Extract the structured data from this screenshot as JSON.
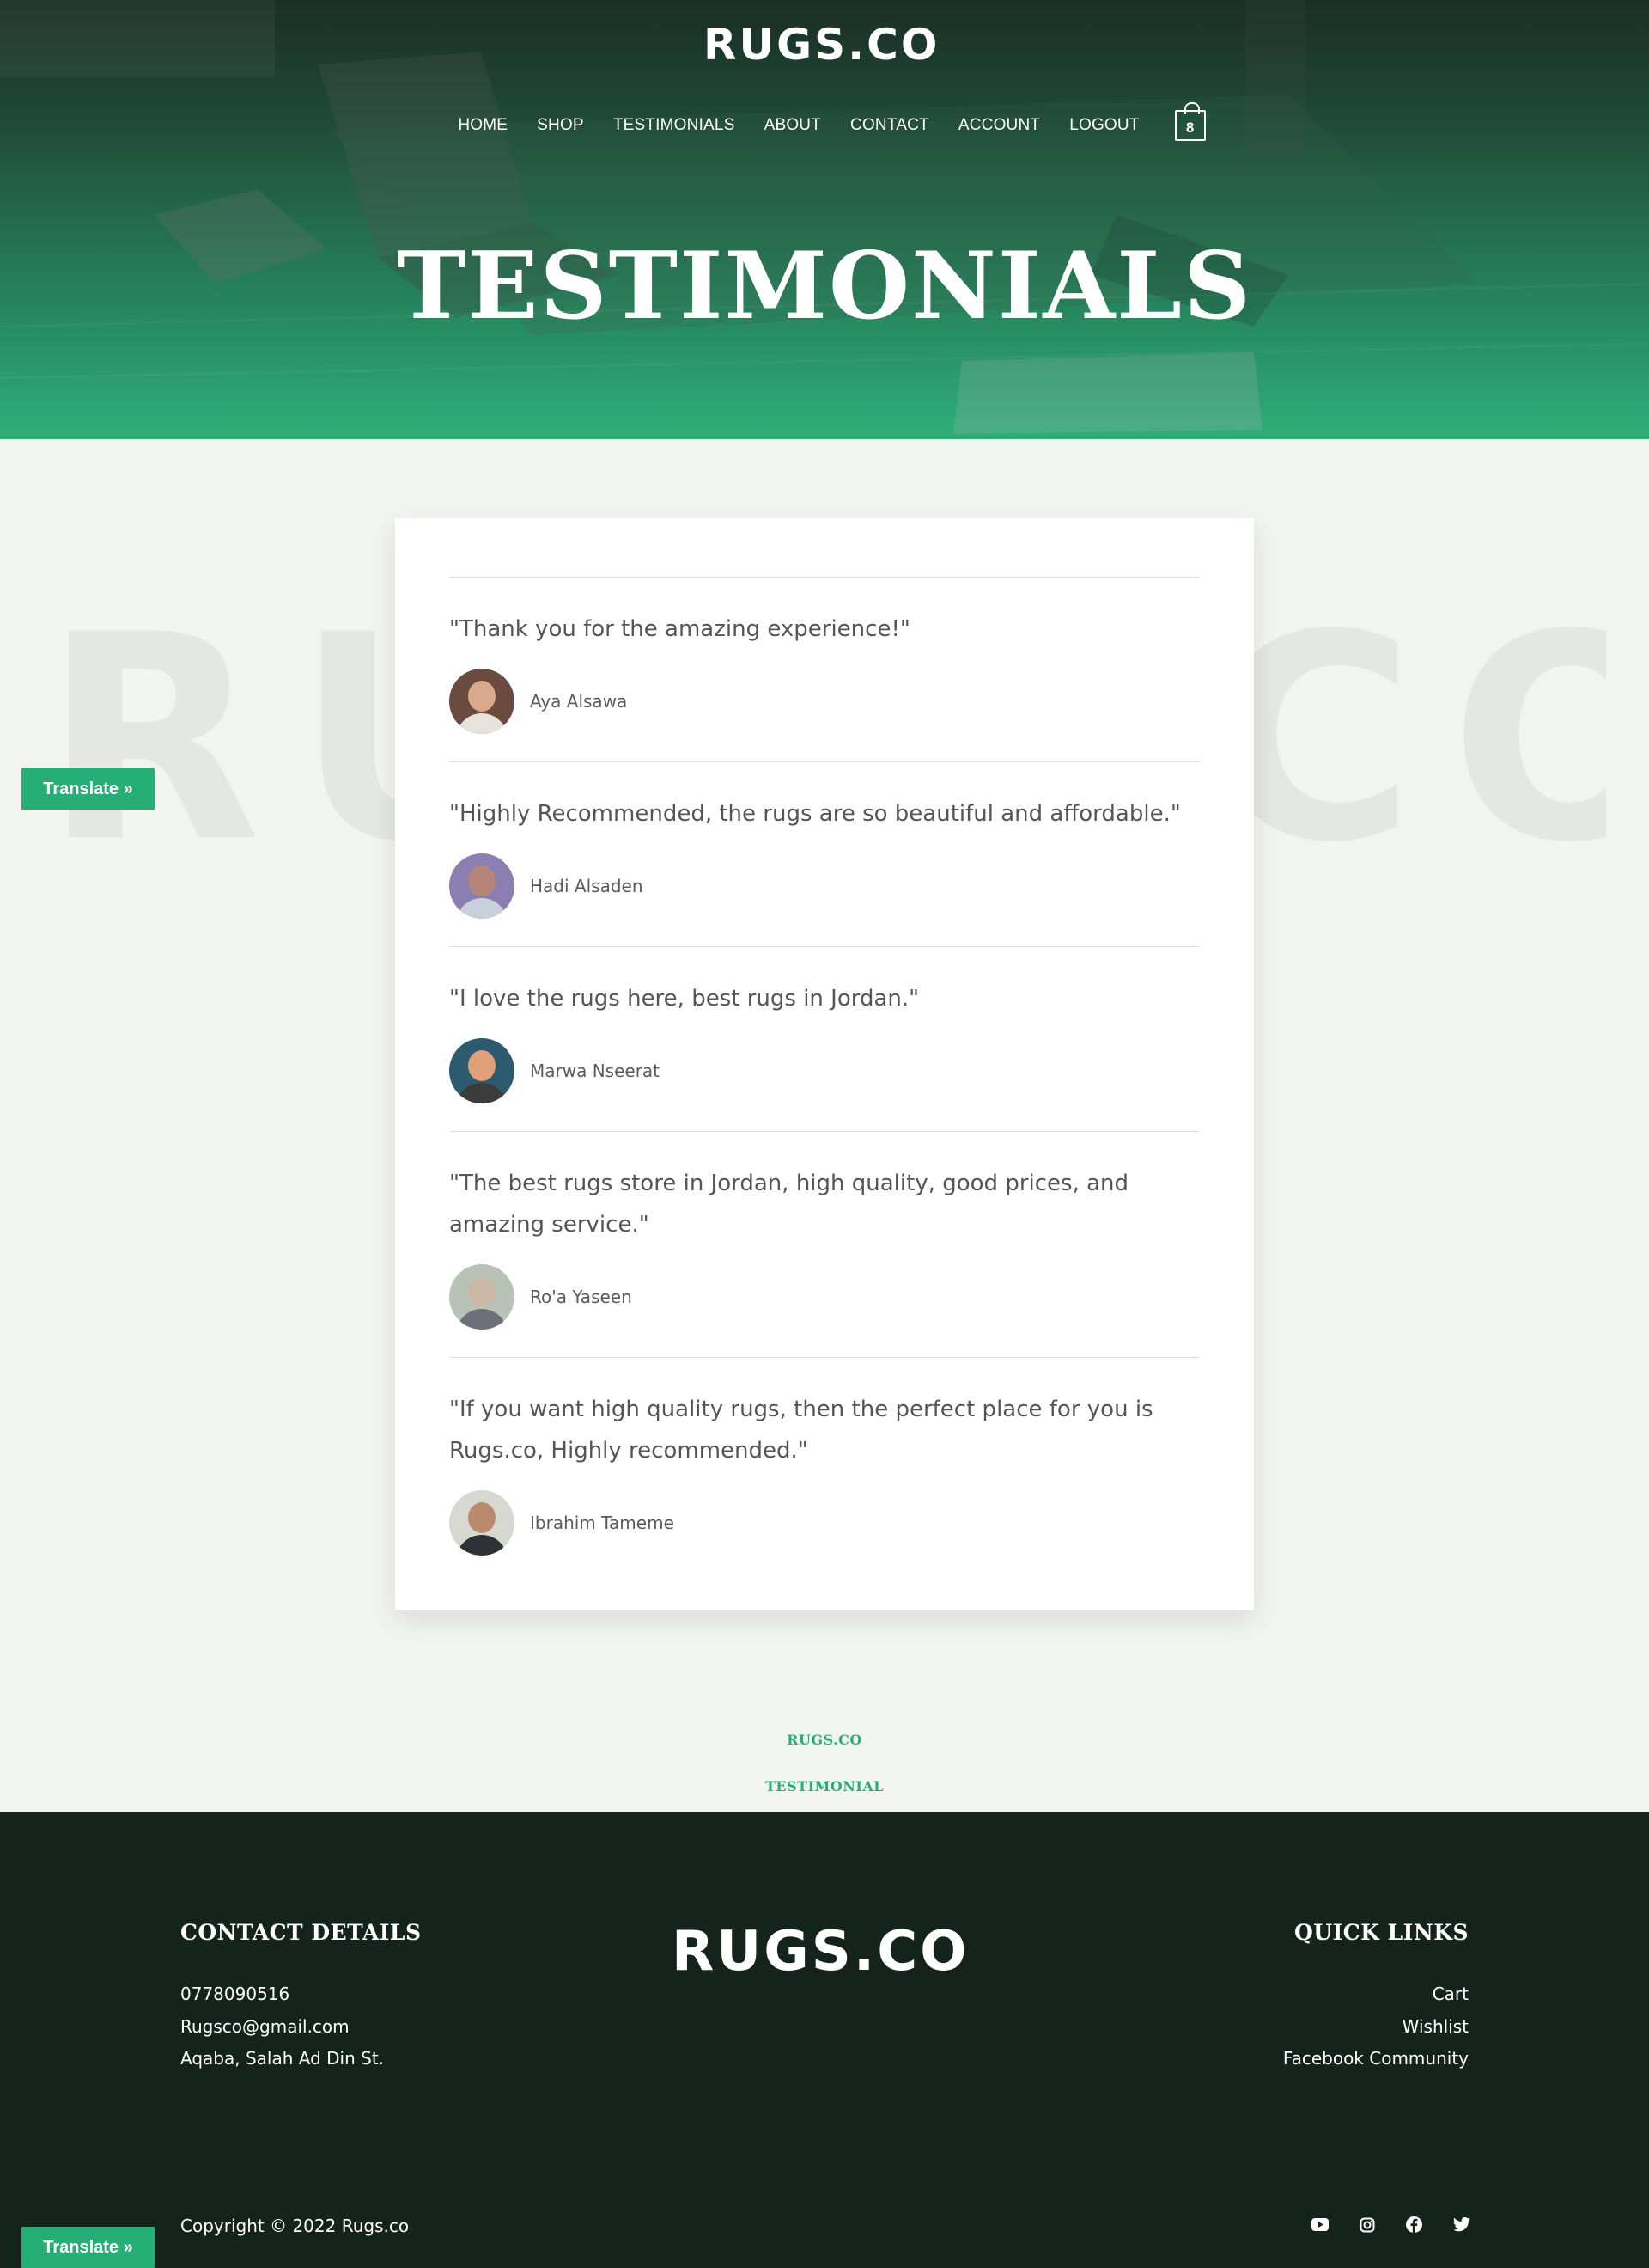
{
  "brand": {
    "logo_text": "RUGS.CO"
  },
  "nav": {
    "items": [
      "HOME",
      "SHOP",
      "TESTIMONIALS",
      "ABOUT",
      "CONTACT",
      "ACCOUNT",
      "LOGOUT"
    ],
    "cart_count": "8"
  },
  "hero": {
    "title": "TESTIMONIALS"
  },
  "translate": {
    "label": "Translate »"
  },
  "testimonials": [
    {
      "quote": "\"Thank you for the amazing experience!\"",
      "name": "Aya Alsawa"
    },
    {
      "quote": "\"Highly Recommended, the rugs are so beautiful and affordable.\"",
      "name": "Hadi Alsaden"
    },
    {
      "quote": "\"I love the rugs here, best rugs in Jordan.\"",
      "name": "Marwa Nseerat"
    },
    {
      "quote": "\"The best rugs store in Jordan, high quality, good prices, and amazing service.\"",
      "name": "Ro'a Yaseen"
    },
    {
      "quote": "\"If you want high quality rugs, then the perfect place for you is Rugs.co, Highly recommended.\"",
      "name": "Ibrahim Tameme"
    }
  ],
  "breadcrumb": {
    "site": "RUGS.CO",
    "page": "TESTIMONIAL"
  },
  "footer": {
    "contact_heading": "CONTACT DETAILS",
    "phone": "0778090516",
    "email": "Rugsco@gmail.com",
    "address": "Aqaba, Salah Ad Din St.",
    "links_heading": "QUICK LINKS",
    "links": [
      "Cart",
      "Wishlist",
      "Facebook Community"
    ],
    "copyright": "Copyright © 2022 Rugs.co",
    "social_icons": [
      "youtube-icon",
      "instagram-icon",
      "facebook-icon",
      "twitter-icon"
    ]
  },
  "colors": {
    "accent": "#27ae77",
    "footer_bg": "#14241d",
    "page_bg": "#f2f4f1"
  }
}
